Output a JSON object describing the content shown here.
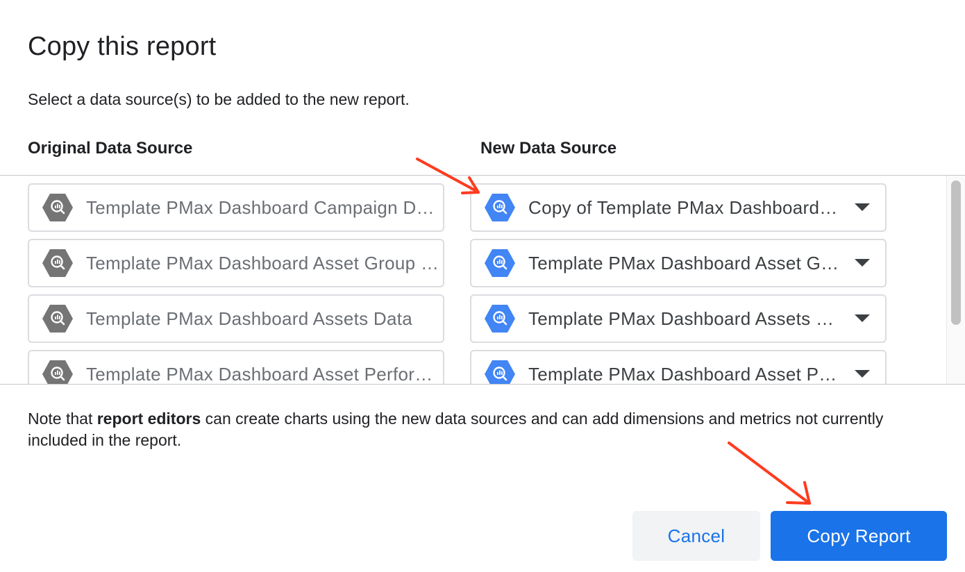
{
  "dialog": {
    "title": "Copy this report",
    "subtitle": "Select a data source(s) to be added to the new report.",
    "headers": {
      "original": "Original Data Source",
      "new": "New Data Source"
    },
    "rows": [
      {
        "original": "Template PMax Dashboard Campaign Data",
        "new": "Copy of Template PMax Dashboard Campaign Data"
      },
      {
        "original": "Template PMax Dashboard Asset Group Data",
        "new": "Template PMax Dashboard Asset Group Data"
      },
      {
        "original": "Template PMax Dashboard Assets Data",
        "new": "Template PMax Dashboard Assets Data"
      },
      {
        "original": "Template PMax Dashboard Asset Performance Data",
        "new": "Template PMax Dashboard Asset Performance Data"
      }
    ],
    "note": {
      "prefix": "Note that ",
      "bold": "report editors",
      "suffix": " can create charts using the new data sources and can add dimensions and metrics not currently included in the report."
    },
    "buttons": {
      "cancel": "Cancel",
      "copy": "Copy Report"
    }
  },
  "colors": {
    "accent": "#1a73e8",
    "original_icon": "#757575",
    "new_icon": "#4285f4",
    "annotation_arrow": "#ff3b1f"
  },
  "icons": {
    "original": "bigquery-hex-icon",
    "new": "bigquery-hex-icon",
    "dropdown": "caret-down-icon"
  }
}
